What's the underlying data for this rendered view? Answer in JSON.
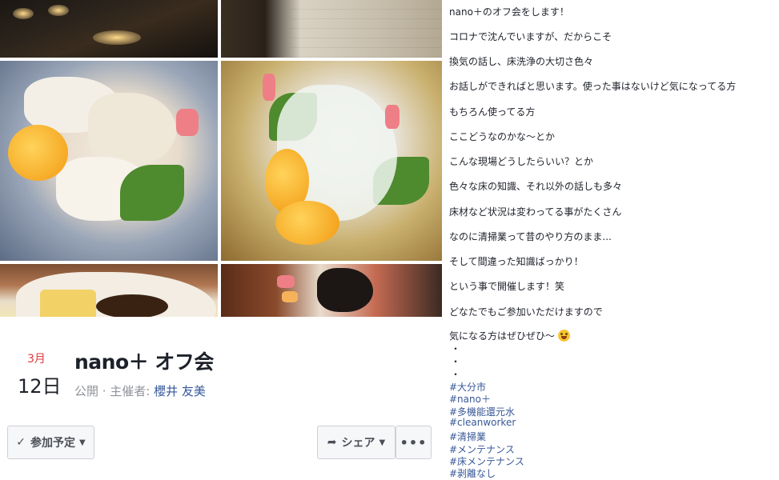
{
  "event": {
    "month": "3月",
    "day": "12日",
    "title": "nano＋ オフ会",
    "meta_prefix": "公開 · 主催者: ",
    "host": "櫻井 友美"
  },
  "actions": {
    "going_label": "参加予定",
    "share_label": "シェア",
    "more_label": "•••"
  },
  "post": {
    "lines": [
      "nano＋のオフ会をします！",
      "コロナで沈んでいますが、だからこそ",
      "換気の話し、床洗浄の大切さ色々",
      "お話しができればと思います。使った事はないけど気になってる方",
      "もちろん使ってる方",
      "ここどうなのかな〜とか",
      "こんな現場どうしたらいい？とか",
      "色々な床の知識、それ以外の話しも多々",
      "床材など状況は変わってる事がたくさん",
      "なのに清掃業って昔のやり方のまま...",
      "そして間違った知識ばっかり！",
      "という事で開催します！笑",
      "どなたでもご参加いただけますので"
    ],
    "closing": "気になる方はぜひぜひ〜",
    "dots": [
      "・",
      "・",
      "・"
    ],
    "hashtags": [
      "#大分市",
      "#nano＋",
      "#多機能還元水",
      "#cleanworker",
      "#清掃業",
      "#メンテナンス",
      "#床メンテナンス",
      "#剥離なし"
    ]
  },
  "colors": {
    "date_month": "#e0393e",
    "link": "#385898",
    "meta": "#90949c"
  }
}
